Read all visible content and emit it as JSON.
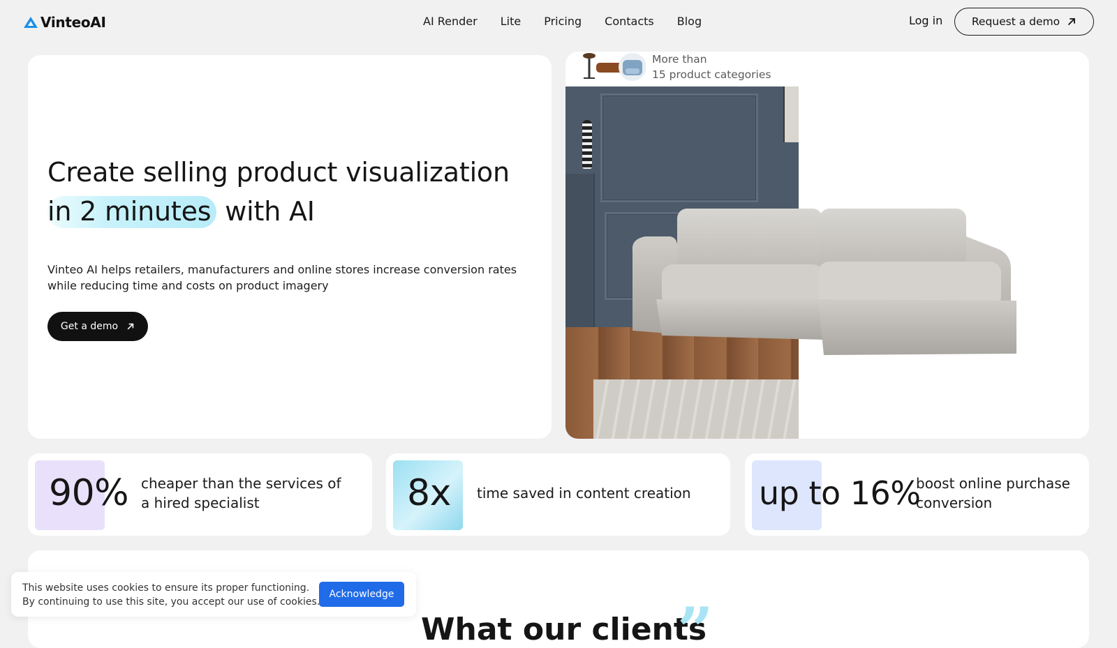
{
  "header": {
    "logo_text": "VinteoAI",
    "nav": [
      "AI Render",
      "Lite",
      "Pricing",
      "Contacts",
      "Blog"
    ],
    "login_label": "Log in",
    "request_demo_label": "Request a demo"
  },
  "hero": {
    "headline_line1": "Create selling product visualization",
    "headline_highlight": "in 2 minutes",
    "headline_rest": "with AI",
    "description": "Vinteo AI helps retailers, manufacturers and online stores increase conversion rates while reducing time and costs on product imagery",
    "cta_label": "Get a demo"
  },
  "categories_badge": {
    "line1": "More than",
    "line2": "15 product categories"
  },
  "stats": [
    {
      "value": "90%",
      "text": "cheaper than the services of a hired specialist",
      "box_color": "#e9e0fb"
    },
    {
      "value": "8x",
      "text": "time saved in content creation",
      "box_color": "#bfeaf5"
    },
    {
      "value": "up to 16%",
      "text": "boost online purchase conversion",
      "box_color": "#dde6fd"
    }
  ],
  "reviews": {
    "title": "What our clients"
  },
  "cookie_banner": {
    "line1": "This website uses cookies to ensure its proper functioning.",
    "line2": "By continuing to use this site, you accept our use of cookies.",
    "button_label": "Acknowledge"
  },
  "colors": {
    "accent": "#1f6be8",
    "highlight": "#c8f2fb",
    "logo_blue": "#1d8fe6"
  }
}
